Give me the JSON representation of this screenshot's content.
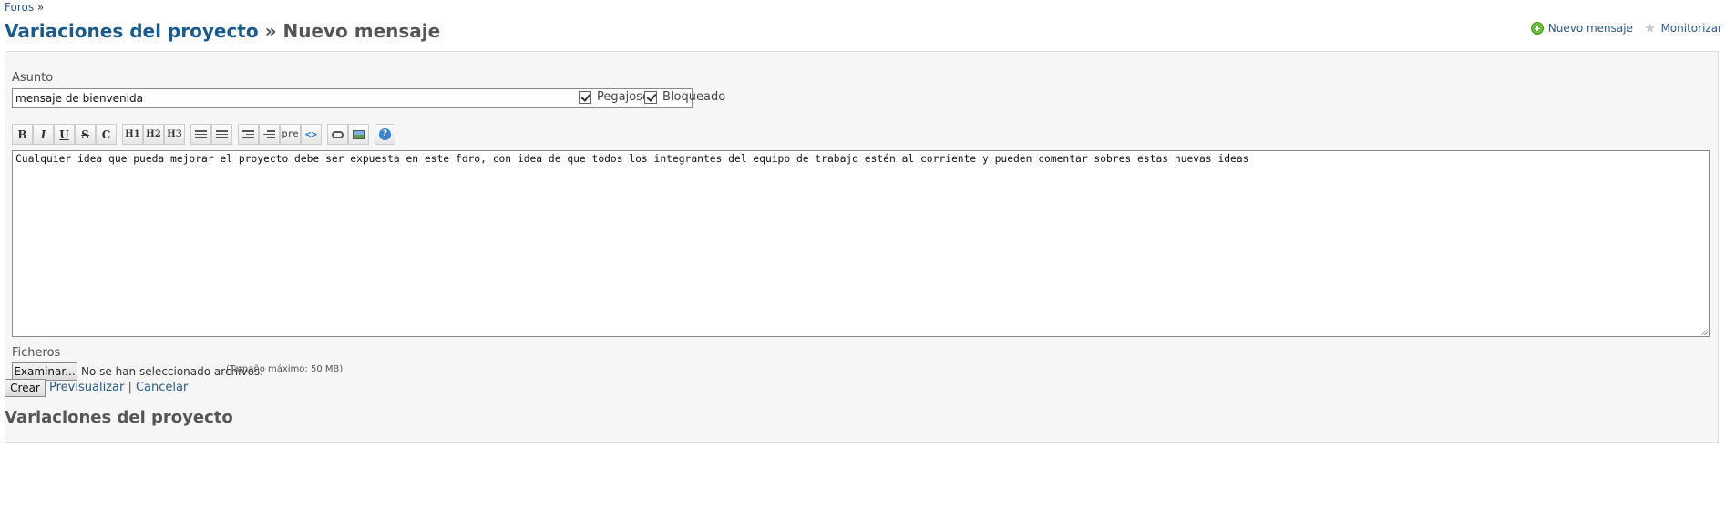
{
  "breadcrumb": {
    "forums": "Foros",
    "sep": "»"
  },
  "title": {
    "project": "Variaciones del proyecto",
    "sep": "»",
    "page": "Nuevo mensaje"
  },
  "contextual": {
    "new_message": "Nuevo mensaje",
    "watch": "Monitorizar"
  },
  "form": {
    "subject_label": "Asunto",
    "subject_value": "mensaje de bienvenida",
    "sticky_label": "Pegajoso",
    "locked_label": "Bloqueado",
    "toolbar": {
      "bold": "B",
      "italic": "I",
      "underline": "U",
      "strike": "S",
      "code_inline": "C",
      "h1": "H1",
      "h2": "H2",
      "h3": "H3",
      "pre": "pre",
      "code": "<>",
      "help": "?"
    },
    "body_text": "Cualquier idea que pueda mejorar el proyecto debe ser expuesta en este foro, con idea de que todos los integrantes del equipo de trabajo estén al corriente y pueden comentar sobres estas nuevas ideas",
    "files_label": "Ficheros",
    "browse_button": "Examinar...",
    "no_files": "No se han seleccionado archivos.",
    "max_size": "(Tamaño máximo: 50 MB)"
  },
  "actions": {
    "create": "Crear",
    "preview": "Previsualizar",
    "sep": "|",
    "cancel": "Cancelar"
  },
  "bottom_title": "Variaciones del proyecto"
}
